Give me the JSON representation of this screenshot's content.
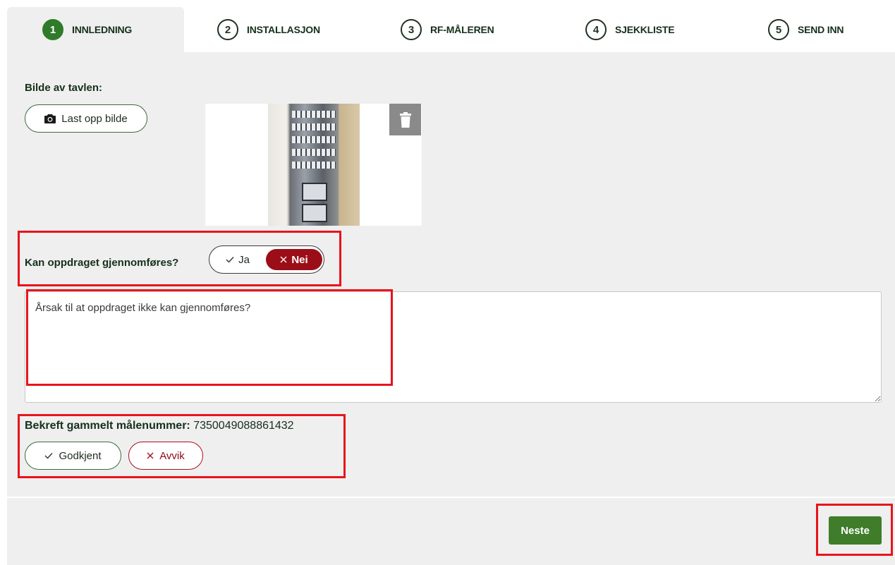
{
  "steps": [
    {
      "num": "1",
      "label": "INNLEDNING",
      "active": true
    },
    {
      "num": "2",
      "label": "INSTALLASJON"
    },
    {
      "num": "3",
      "label": "RF-MÅLEREN"
    },
    {
      "num": "4",
      "label": "SJEKKLISTE"
    },
    {
      "num": "5",
      "label": "SEND INN"
    }
  ],
  "photo": {
    "label": "Bilde av tavlen:",
    "upload_label": "Last opp bilde"
  },
  "feasibility": {
    "question": "Kan oppdraget gjennomføres?",
    "yes_label": "Ja",
    "no_label": "Nei",
    "selected": "Nei"
  },
  "reason": {
    "placeholder": "Årsak til at oppdraget ikke kan gjennomføres?",
    "value": ""
  },
  "meter": {
    "label": "Bekreft gammelt målenummer:",
    "number": "7350049088861432",
    "approve_label": "Godkjent",
    "deviate_label": "Avvik"
  },
  "footer": {
    "next_label": "Neste"
  },
  "colors": {
    "brand_green": "#2f7b2a",
    "danger_red": "#9b0e17",
    "annotation_red": "#e8141b",
    "panel_bg": "#efefef"
  }
}
